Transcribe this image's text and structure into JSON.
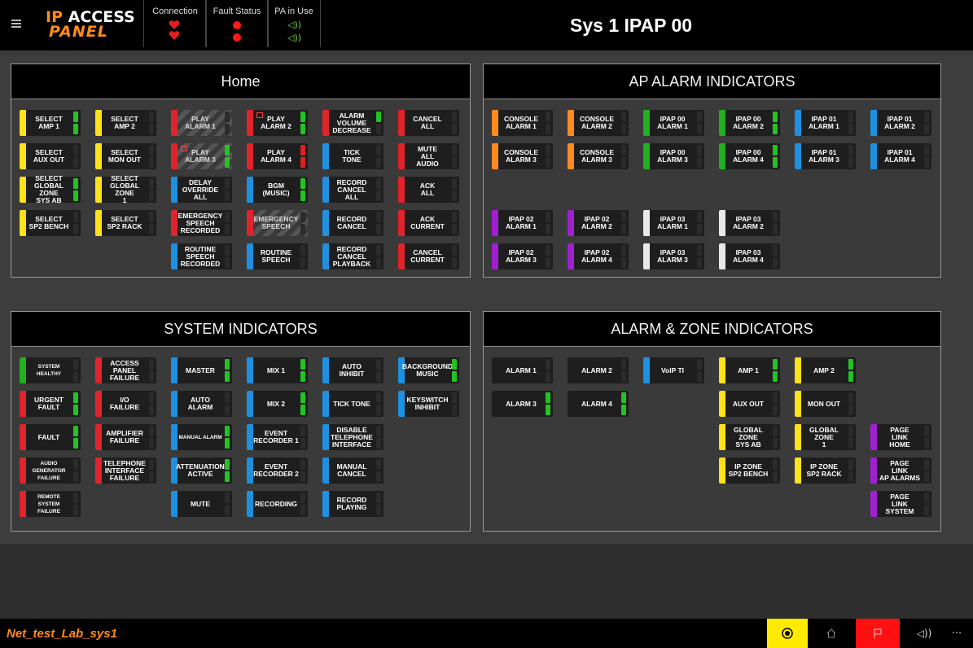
{
  "header": {
    "logo_line1_ip": "IP",
    "logo_line1_access": "ACCESS",
    "logo_line2": "PANEL",
    "connection_label": "Connection",
    "fault_status_label": "Fault Status",
    "pa_in_use_label": "PA in Use",
    "system_name": "Sys 1 IPAP 00"
  },
  "colors": {
    "yellow": "#ffe11a",
    "red": "#e0242b",
    "blue": "#1e90e0",
    "green": "#20b020",
    "orange": "#ff8a1e",
    "purple": "#a020d0",
    "white": "#e8e8e8",
    "ind_green": "#22c322",
    "ind_red": "#e02020",
    "logo_orange": "#ff8c1a"
  },
  "panels": {
    "home": {
      "title": "Home"
    },
    "ap_alarm": {
      "title": "AP ALARM INDICATORS"
    },
    "system": {
      "title": "SYSTEM INDICATORS"
    },
    "alarm_zone": {
      "title": "ALARM & ZONE INDICATORS"
    }
  },
  "home_buttons": [
    {
      "label": "SELECT\nAMP 1",
      "color": "yellow",
      "ind": [
        "green",
        "green"
      ]
    },
    {
      "label": "SELECT\nAMP 2",
      "color": "yellow",
      "ind": [
        "off",
        "off"
      ]
    },
    {
      "label": "PLAY\nALARM 1",
      "color": "red",
      "hatched": true,
      "ind": [
        "off",
        "off"
      ]
    },
    {
      "label": "PLAY\nALARM 2",
      "color": "red",
      "square": true,
      "ind": [
        "green",
        "green"
      ]
    },
    {
      "label": "ALARM\nVOLUME\nDECREASE",
      "color": "red",
      "ind": [
        "green",
        "off"
      ]
    },
    {
      "label": "CANCEL\nALL",
      "color": "red",
      "ind": [
        "off",
        "off"
      ]
    },
    {
      "label": "SELECT\nAUX OUT",
      "color": "yellow",
      "ind": [
        "off",
        "off"
      ]
    },
    {
      "label": "SELECT\nMON OUT",
      "color": "yellow",
      "ind": [
        "off",
        "off"
      ]
    },
    {
      "label": "PLAY\nALARM 3",
      "color": "red",
      "hatched": true,
      "square": true,
      "ind": [
        "green",
        "green"
      ]
    },
    {
      "label": "PLAY\nALARM 4",
      "color": "red",
      "ind": [
        "red",
        "red"
      ]
    },
    {
      "label": "TICK\nTONE",
      "color": "blue",
      "ind": [
        "off",
        "off"
      ]
    },
    {
      "label": "MUTE\nALL\nAUDIO",
      "color": "red",
      "ind": [
        "off",
        "off"
      ]
    },
    {
      "label": "SELECT\nGLOBAL ZONE\nSYS AB",
      "color": "yellow",
      "ind": [
        "green",
        "green"
      ]
    },
    {
      "label": "SELECT\nGLOBAL ZONE\n1",
      "color": "yellow",
      "ind": [
        "off",
        "off"
      ]
    },
    {
      "label": "DELAY\nOVERRIDE\nALL",
      "color": "blue",
      "ind": [
        "off",
        "off"
      ]
    },
    {
      "label": "BGM\n(MUSIC)",
      "color": "blue",
      "ind": [
        "green",
        "green"
      ]
    },
    {
      "label": "RECORD\nCANCEL\nALL",
      "color": "blue",
      "ind": [
        "off",
        "off"
      ]
    },
    {
      "label": "ACK\nALL",
      "color": "red",
      "ind": [
        "off",
        "off"
      ]
    },
    {
      "label": "SELECT\nSP2 BENCH",
      "color": "yellow",
      "ind": [
        "off",
        "off"
      ]
    },
    {
      "label": "SELECT\nSP2 RACK",
      "color": "yellow",
      "ind": [
        "off",
        "off"
      ]
    },
    {
      "label": "EMERGENCY\nSPEECH\nRECORDED",
      "color": "red",
      "ind": [
        "off",
        "off"
      ]
    },
    {
      "label": "EMERGENCY\nSPEECH",
      "color": "red",
      "hatched": true,
      "ind": [
        "off",
        "off"
      ]
    },
    {
      "label": "RECORD\nCANCEL",
      "color": "blue",
      "ind": [
        "off",
        "off"
      ]
    },
    {
      "label": "ACK\nCURRENT",
      "color": "red",
      "ind": [
        "off",
        "off"
      ]
    },
    {
      "label": "ROUTINE\nSPEECH\nRECORDED",
      "color": "blue",
      "ind": [
        "off",
        "off"
      ]
    },
    {
      "label": "ROUTINE\nSPEECH",
      "color": "blue",
      "ind": [
        "off",
        "off"
      ]
    },
    {
      "label": "RECORD\nCANCEL\nPLAYBACK",
      "color": "blue",
      "ind": [
        "off",
        "off"
      ]
    },
    {
      "label": "CANCEL\nCURRENT",
      "color": "red",
      "ind": [
        "off",
        "off"
      ]
    }
  ],
  "ap_buttons": [
    {
      "label": "CONSOLE\nALARM 1",
      "color": "orange",
      "ind": [
        "off",
        "off"
      ]
    },
    {
      "label": "CONSOLE\nALARM 2",
      "color": "orange",
      "ind": [
        "off",
        "off"
      ]
    },
    {
      "label": "IPAP 00\nALARM 1",
      "color": "green",
      "ind": [
        "off",
        "off"
      ]
    },
    {
      "label": "IPAP 00\nALARM 2",
      "color": "green",
      "ind": [
        "green",
        "green"
      ]
    },
    {
      "label": "IPAP 01\nALARM 1",
      "color": "blue",
      "ind": [
        "off",
        "off"
      ]
    },
    {
      "label": "IPAP 01\nALARM 2",
      "color": "blue",
      "ind": [
        "off",
        "off"
      ]
    },
    {
      "label": "CONSOLE\nALARM 3",
      "color": "orange",
      "ind": [
        "off",
        "off"
      ]
    },
    {
      "label": "CONSOLE\nALARM 3",
      "color": "orange",
      "ind": [
        "off",
        "off"
      ]
    },
    {
      "label": "IPAP 00\nALARM 3",
      "color": "green",
      "ind": [
        "off",
        "off"
      ]
    },
    {
      "label": "IPAP 00\nALARM 4",
      "color": "green",
      "ind": [
        "green",
        "green"
      ]
    },
    {
      "label": "IPAP 01\nALARM 3",
      "color": "blue",
      "ind": [
        "off",
        "off"
      ]
    },
    {
      "label": "IPAP 01\nALARM 4",
      "color": "blue",
      "ind": [
        "off",
        "off"
      ]
    },
    {
      "label": "IPAP 02\nALARM 1",
      "color": "purple",
      "ind": [
        "off",
        "off"
      ]
    },
    {
      "label": "IPAP 02\nALARM 2",
      "color": "purple",
      "ind": [
        "off",
        "off"
      ]
    },
    {
      "label": "IPAP 03\nALARM 1",
      "color": "white",
      "ind": [
        "off",
        "off"
      ]
    },
    {
      "label": "IPAP 03\nALARM 2",
      "color": "white",
      "ind": [
        "off",
        "off"
      ]
    },
    {
      "label": "IPAP 02\nALARM 3",
      "color": "purple",
      "ind": [
        "off",
        "off"
      ]
    },
    {
      "label": "IPAP 02\nALARM 4",
      "color": "purple",
      "ind": [
        "off",
        "off"
      ]
    },
    {
      "label": "IPAP 03\nALARM 3",
      "color": "white",
      "ind": [
        "off",
        "off"
      ]
    },
    {
      "label": "IPAP 03\nALARM 4",
      "color": "white",
      "ind": [
        "off",
        "off"
      ]
    }
  ],
  "system_buttons": [
    {
      "label": "SYSTEM HEALTHY",
      "color": "green",
      "ind": [
        "off",
        "off"
      ]
    },
    {
      "label": "ACCESS PANEL\nFAILURE",
      "color": "red",
      "ind": [
        "off",
        "off"
      ]
    },
    {
      "label": "MASTER",
      "color": "blue",
      "ind": [
        "green",
        "green"
      ]
    },
    {
      "label": "MIX 1",
      "color": "blue",
      "ind": [
        "green",
        "green"
      ]
    },
    {
      "label": "AUTO\nINHIBIT",
      "color": "blue",
      "ind": [
        "off",
        "off"
      ]
    },
    {
      "label": "BACKGROUND\nMUSIC",
      "color": "blue",
      "ind": [
        "green",
        "green"
      ]
    },
    {
      "label": "URGENT FAULT",
      "color": "red",
      "ind": [
        "green",
        "green"
      ]
    },
    {
      "label": "I/O\nFAILURE",
      "color": "red",
      "ind": [
        "off",
        "off"
      ]
    },
    {
      "label": "AUTO ALARM",
      "color": "blue",
      "ind": [
        "off",
        "off"
      ]
    },
    {
      "label": "MIX 2",
      "color": "blue",
      "ind": [
        "green",
        "green"
      ]
    },
    {
      "label": "TICK TONE",
      "color": "blue",
      "ind": [
        "off",
        "off"
      ]
    },
    {
      "label": "KEYSWITCH\nINHIBIT",
      "color": "blue",
      "ind": [
        "off",
        "off"
      ]
    },
    {
      "label": "FAULT",
      "color": "red",
      "ind": [
        "green",
        "green"
      ]
    },
    {
      "label": "AMPLIFIER\nFAILURE",
      "color": "red",
      "ind": [
        "off",
        "off"
      ]
    },
    {
      "label": "MANUAL ALARM",
      "color": "blue",
      "ind": [
        "green",
        "green"
      ]
    },
    {
      "label": "EVENT\nRECORDER 1",
      "color": "blue",
      "ind": [
        "off",
        "off"
      ]
    },
    {
      "label": "DISABLE\nTELEPHONE\nINTERFACE",
      "color": "blue",
      "ind": [
        "off",
        "off"
      ]
    },
    {
      "label": "AUDIO GENERATOR\nFAILURE",
      "color": "red",
      "ind": [
        "off",
        "off"
      ]
    },
    {
      "label": "TELEPHONE\nINTERFACE\nFAILURE",
      "color": "red",
      "ind": [
        "off",
        "off"
      ]
    },
    {
      "label": "ATTENUATION\nACTIVE",
      "color": "blue",
      "ind": [
        "green",
        "green"
      ]
    },
    {
      "label": "EVENT\nRECORDER 2",
      "color": "blue",
      "ind": [
        "off",
        "off"
      ]
    },
    {
      "label": "MANUAL\nCANCEL",
      "color": "blue",
      "ind": [
        "off",
        "off"
      ]
    },
    {
      "label": "REMOTE SYSTEM\nFAILURE",
      "color": "red",
      "ind": [
        "off",
        "off"
      ]
    },
    {
      "label": "MUTE",
      "color": "blue",
      "ind": [
        "off",
        "off"
      ]
    },
    {
      "label": "RECORDING",
      "color": "blue",
      "ind": [
        "off",
        "off"
      ]
    },
    {
      "label": "RECORD\nPLAYING",
      "color": "blue",
      "ind": [
        "off",
        "off"
      ]
    }
  ],
  "zone_buttons": [
    {
      "label": "ALARM 1",
      "color": "none",
      "ind": [
        "off",
        "off"
      ]
    },
    {
      "label": "ALARM 2",
      "color": "none",
      "ind": [
        "off",
        "off"
      ]
    },
    {
      "label": "VoIP TI",
      "color": "blue",
      "ind": [
        "off",
        "off"
      ]
    },
    {
      "label": "AMP 1",
      "color": "yellow",
      "ind": [
        "green",
        "green"
      ]
    },
    {
      "label": "AMP 2",
      "color": "yellow",
      "ind": [
        "green",
        "green"
      ]
    },
    {
      "label": "ALARM 3",
      "color": "none",
      "ind": [
        "green",
        "green"
      ]
    },
    {
      "label": "ALARM 4",
      "color": "none",
      "ind": [
        "green",
        "green"
      ]
    },
    {
      "label": "AUX OUT",
      "color": "yellow",
      "ind": [
        "off",
        "off"
      ]
    },
    {
      "label": "MON OUT",
      "color": "yellow",
      "ind": [
        "off",
        "off"
      ]
    },
    {
      "label": "GLOBAL ZONE\nSYS AB",
      "color": "yellow",
      "ind": [
        "off",
        "off"
      ]
    },
    {
      "label": "GLOBAL ZONE\n1",
      "color": "yellow",
      "ind": [
        "off",
        "off"
      ]
    },
    {
      "label": "PAGE\nLINK\nHOME",
      "color": "purple",
      "ind": [
        "off",
        "off"
      ]
    },
    {
      "label": "IP ZONE\nSP2 BENCH",
      "color": "yellow",
      "ind": [
        "off",
        "off"
      ]
    },
    {
      "label": "IP ZONE\nSP2 RACK",
      "color": "yellow",
      "ind": [
        "off",
        "off"
      ]
    },
    {
      "label": "PAGE\nLINK\nAP ALARMS",
      "color": "purple",
      "ind": [
        "off",
        "off"
      ]
    },
    {
      "label": "PAGE\nLINK\nSYSTEM",
      "color": "purple",
      "ind": [
        "off",
        "off"
      ]
    }
  ],
  "footer": {
    "system_net_label": "Net_test_Lab_sys1",
    "more_label": "···"
  }
}
